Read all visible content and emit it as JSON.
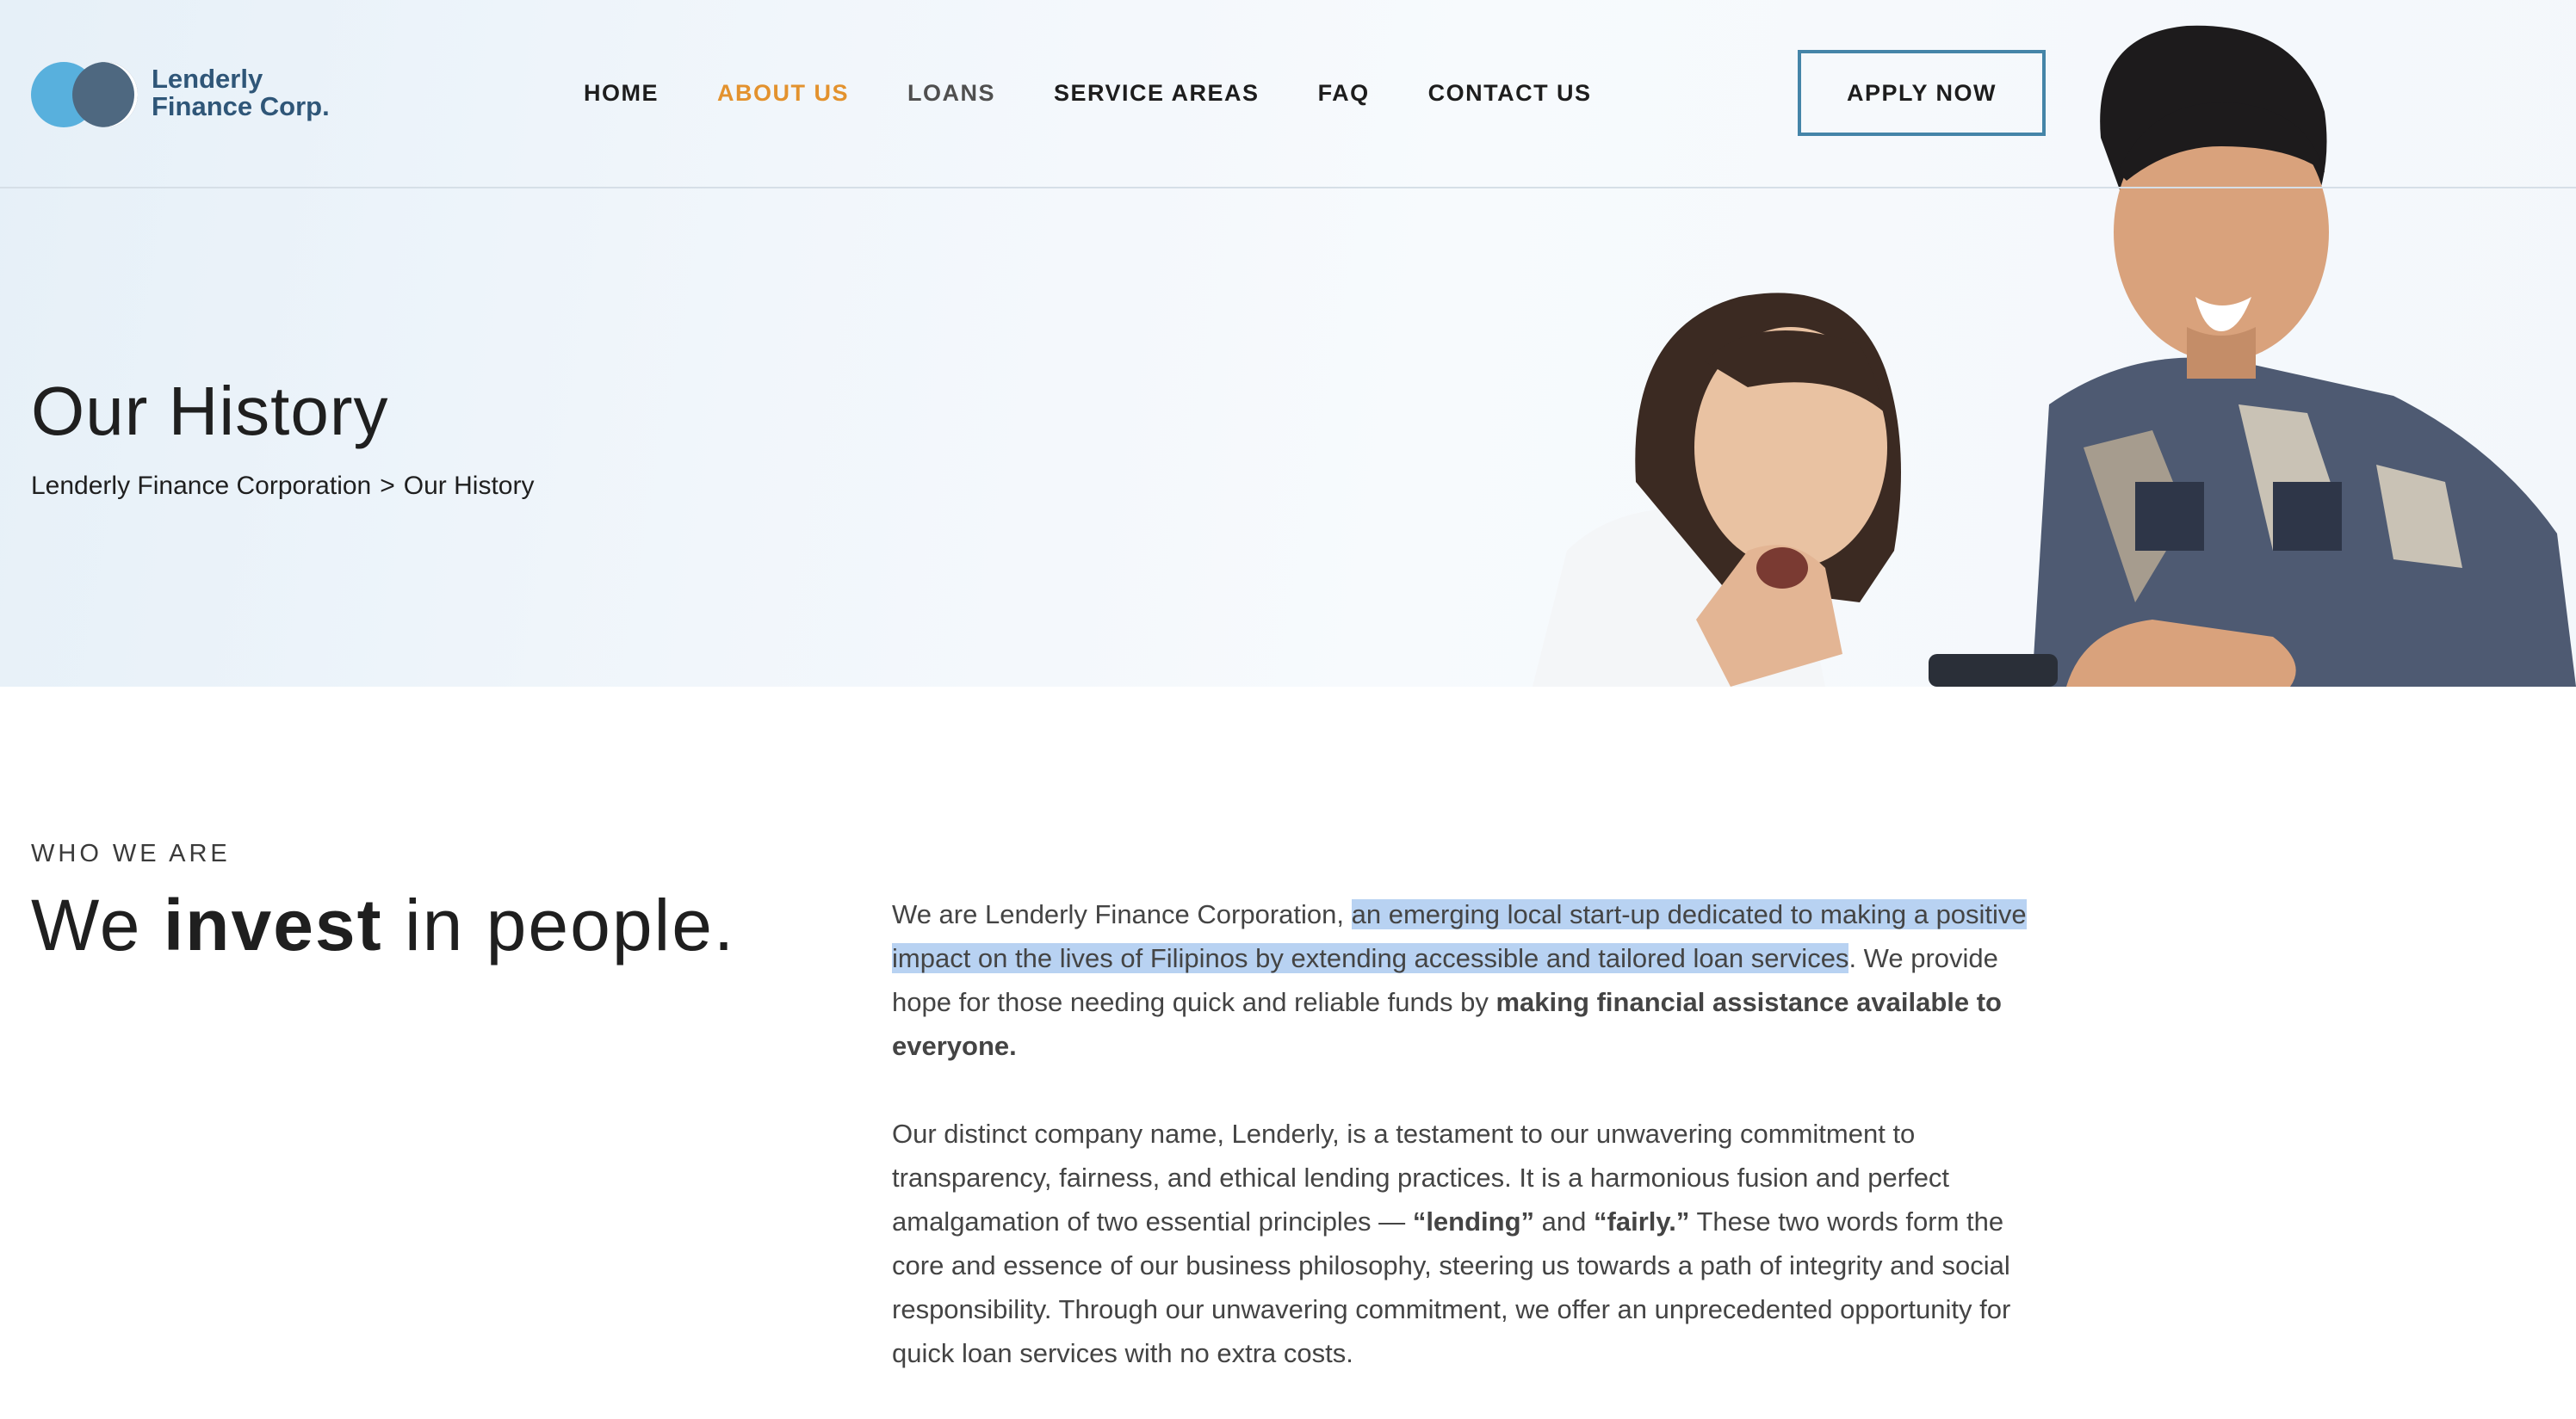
{
  "brand": {
    "logo_line1": "Lenderly",
    "logo_line2": "Finance Corp.",
    "primary_color": "#2f5678",
    "accent_color": "#e3922e",
    "light_blue": "#58b0dd"
  },
  "nav": {
    "items": [
      {
        "label": "HOME",
        "state": "default"
      },
      {
        "label": "ABOUT US",
        "state": "active"
      },
      {
        "label": "LOANS",
        "state": "muted"
      },
      {
        "label": "SERVICE AREAS",
        "state": "default"
      },
      {
        "label": "FAQ",
        "state": "default"
      },
      {
        "label": "CONTACT US",
        "state": "default"
      }
    ],
    "cta_label": "APPLY NOW"
  },
  "hero": {
    "title": "Our History",
    "breadcrumb": {
      "root": "Lenderly Finance Corporation",
      "separator": ">",
      "current": "Our History"
    }
  },
  "content": {
    "eyebrow": "WHO WE ARE",
    "headline_pre": "We",
    "headline_bold": "invest",
    "headline_post": "in people.",
    "para1": {
      "plain_start": "We are Lenderly Finance Corporation,",
      "highlighted": "an emerging local start-up dedicated to making a positive impact on the lives of Filipinos by extending accessible and tailored loan services",
      "after_highlight": ". We provide hope for those needing quick and reliable funds by",
      "bold_end": "making financial assistance available to everyone."
    },
    "para2": {
      "part1": "Our distinct company name, Lenderly, is a testament to our unwavering commitment to transparency, fairness, and ethical lending practices. It is a harmonious fusion and perfect amalgamation of two essential principles —",
      "bold1": "“lending”",
      "part2": "and",
      "bold2": "“fairly.”",
      "part3": "These two words form the core and essence of our business philosophy, steering us towards a path of integrity and social responsibility. Through our unwavering commitment, we offer an unprecedented opportunity for quick loan services with no extra costs."
    }
  }
}
